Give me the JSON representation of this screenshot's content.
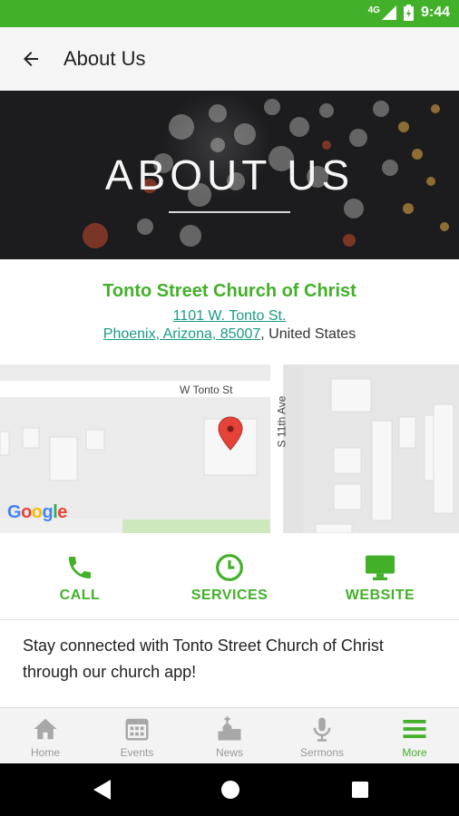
{
  "status_bar": {
    "network": "4G",
    "time": "9:44",
    "color": "#43b02a"
  },
  "app_bar": {
    "title": "About Us"
  },
  "hero": {
    "title": "ABOUT US"
  },
  "church": {
    "name": "Tonto Street Church of Christ",
    "address_line1": "1101 W. Tonto St.",
    "address_line2": "Phoenix, Arizona, 85007",
    "country_suffix": ", United States"
  },
  "map": {
    "street_label_horizontal": "W Tonto St",
    "street_label_vertical": "S 11th Ave",
    "logo": "Google"
  },
  "actions": [
    {
      "label": "CALL",
      "icon": "phone-icon"
    },
    {
      "label": "SERVICES",
      "icon": "clock-icon"
    },
    {
      "label": "WEBSITE",
      "icon": "monitor-icon"
    }
  ],
  "description": "Stay connected with Tonto Street Church of Christ through our church app!",
  "tabs": [
    {
      "label": "Home",
      "icon": "home-icon",
      "active": false
    },
    {
      "label": "Events",
      "icon": "calendar-icon",
      "active": false
    },
    {
      "label": "News",
      "icon": "church-icon",
      "active": false
    },
    {
      "label": "Sermons",
      "icon": "microphone-icon",
      "active": false
    },
    {
      "label": "More",
      "icon": "menu-icon",
      "active": true
    }
  ],
  "colors": {
    "accent": "#43b02a",
    "link": "#1a9a84",
    "tab_inactive": "#9a9a9a"
  }
}
